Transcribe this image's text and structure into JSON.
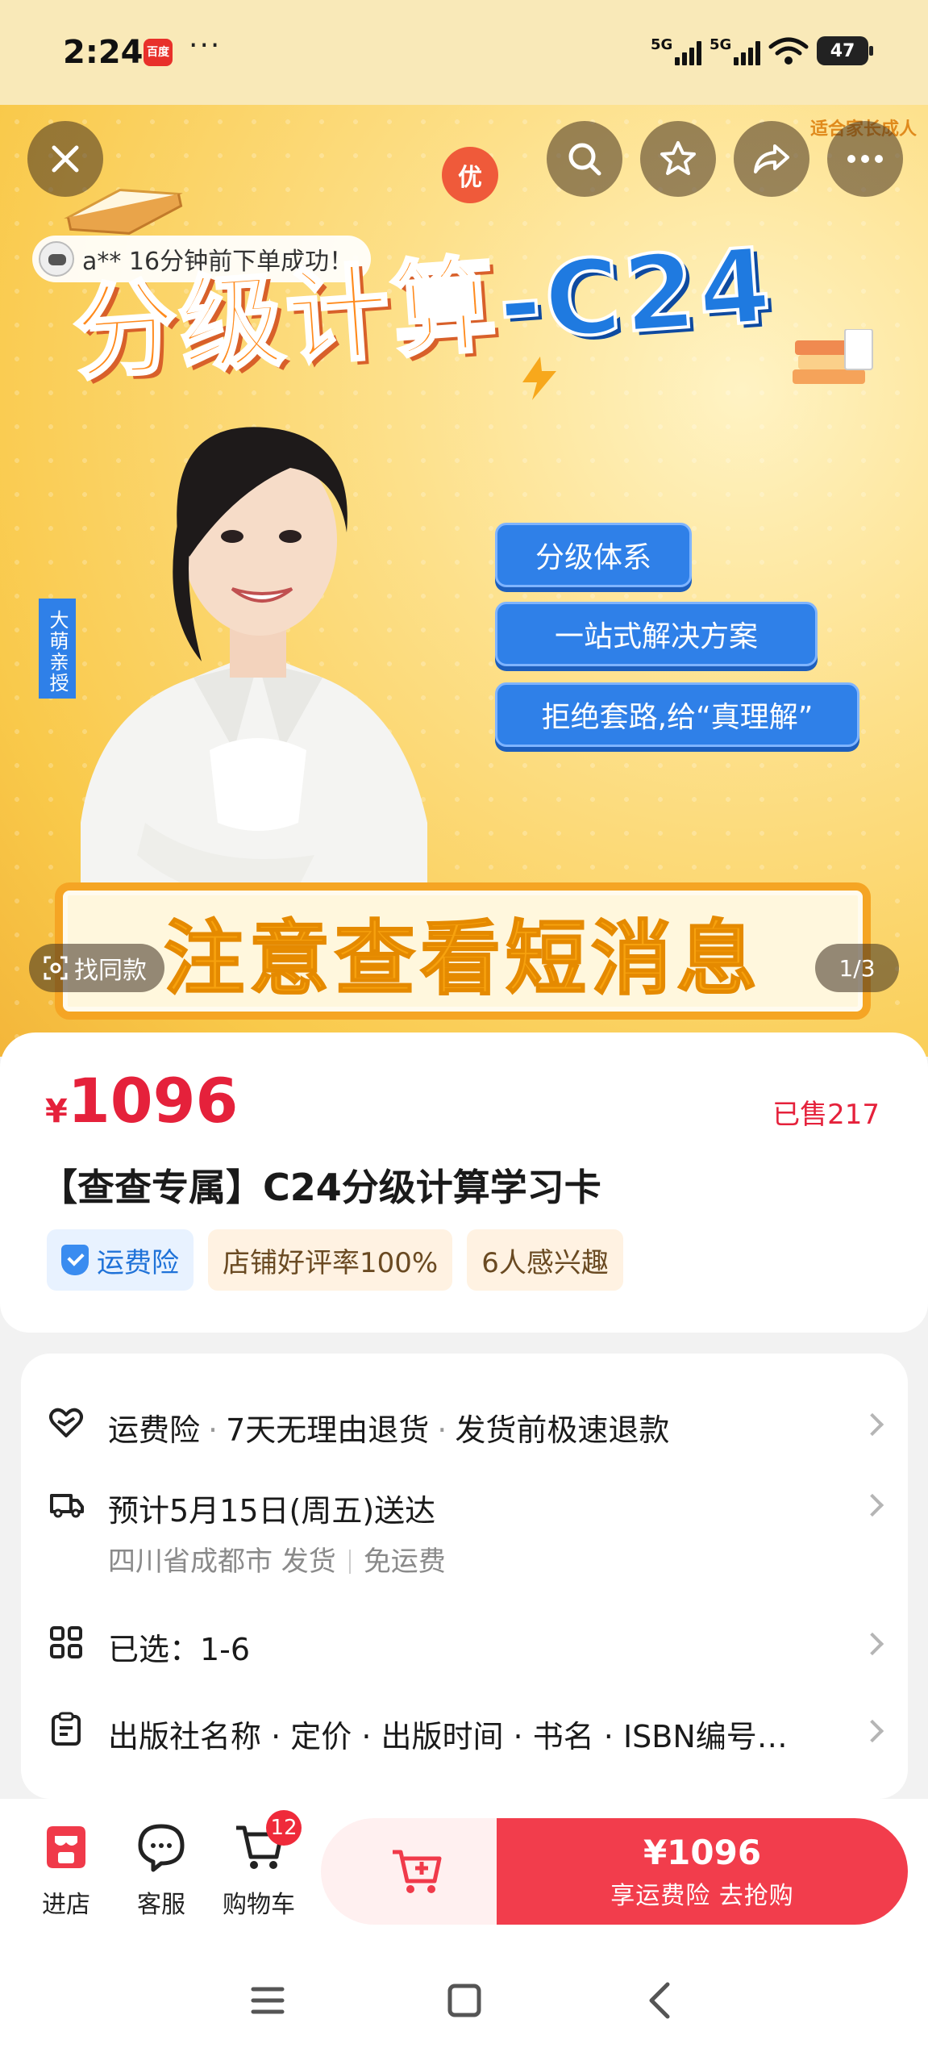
{
  "status_bar": {
    "time": "2:24",
    "app_icon_text": "百度",
    "more": "···",
    "signal1_label": "5G",
    "signal2_label": "5G",
    "battery": "47"
  },
  "hero": {
    "top_right_tag": "适合家长成人",
    "title_left": "分级计算",
    "title_right": "-C24",
    "you_badge": "优",
    "order_toast": "a** 16分钟前下单成功！",
    "side_tag": "大萌亲授",
    "features": [
      "分级体系",
      "一站式解决方案",
      "拒绝套路,给“真理解”"
    ],
    "notice": "注意查看短消息",
    "find_same": "找同款",
    "page_indicator": "1/3"
  },
  "product": {
    "currency": "¥",
    "price": "1096",
    "sold": "已售217",
    "title": "【查查专属】C24分级计算学习卡",
    "badges": [
      "运费险",
      "店铺好评率100%",
      "6人感兴趣"
    ]
  },
  "info": {
    "service": [
      "运费险",
      "7天无理由退货",
      "发货前极速退款"
    ],
    "delivery": "预计5月15日(周五)送达",
    "ship_from": "四川省成都市 发货",
    "shipping_fee": "免运费",
    "selected": "已选：1-6",
    "params": "出版社名称 · 定价 · 出版时间 · 书名 · ISBN编号…"
  },
  "bottom_bar": {
    "shop": "进店",
    "service": "客服",
    "cart": "购物车",
    "cart_count": "12",
    "buy_price": "¥1096",
    "buy_sub": "享运费险 去抢购"
  },
  "colors": {
    "accent_red": "#e5213b",
    "buy_button": "#f23d4c",
    "hero_yellow": "#f9c94a",
    "feature_blue": "#2f80e8"
  }
}
